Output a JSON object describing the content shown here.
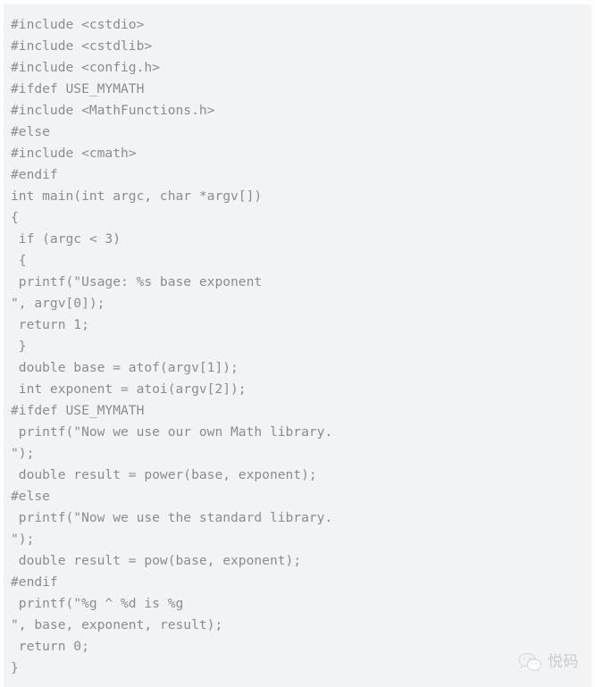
{
  "colors": {
    "page_background": "#fdfdfd",
    "code_background": "#f2f3f5",
    "code_text": "#8c8c8c",
    "watermark_text": "#c9cbcf"
  },
  "code_block": {
    "language": "c",
    "lines": [
      "#include <cstdio>",
      "#include <cstdlib>",
      "#include <config.h>",
      "#ifdef USE_MYMATH",
      "#include <MathFunctions.h>",
      "#else",
      "#include <cmath>",
      "#endif",
      "int main(int argc, char *argv[])",
      "{",
      " if (argc < 3)",
      " {",
      " printf(\"Usage: %s base exponent",
      "\", argv[0]);",
      " return 1;",
      " }",
      " double base = atof(argv[1]);",
      " int exponent = atoi(argv[2]);",
      "#ifdef USE_MYMATH",
      " printf(\"Now we use our own Math library.",
      "\");",
      " double result = power(base, exponent);",
      "#else",
      " printf(\"Now we use the standard library.",
      "\");",
      " double result = pow(base, exponent);",
      "#endif",
      " printf(\"%g ^ %d is %g",
      "\", base, exponent, result);",
      " return 0;",
      "}"
    ]
  },
  "watermark": {
    "icon": "wechat-icon",
    "label": "悦码"
  }
}
